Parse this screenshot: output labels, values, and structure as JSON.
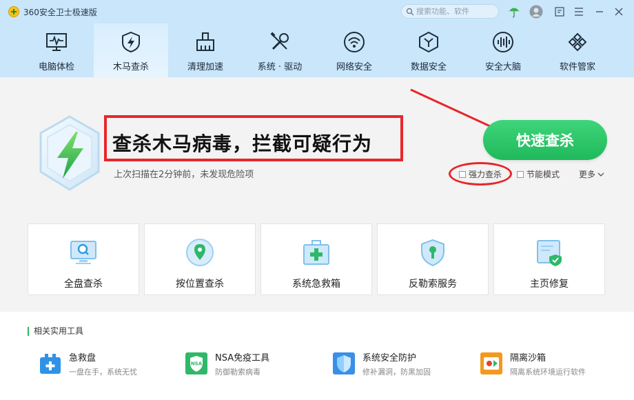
{
  "app": {
    "title": "360安全卫士极速版"
  },
  "search": {
    "placeholder": "搜索功能、软件"
  },
  "nav": {
    "items": [
      {
        "label": "电脑体检"
      },
      {
        "label": "木马查杀"
      },
      {
        "label": "清理加速"
      },
      {
        "label": "系统 · 驱动"
      },
      {
        "label": "网络安全"
      },
      {
        "label": "数据安全"
      },
      {
        "label": "安全大脑"
      },
      {
        "label": "软件管家"
      }
    ],
    "active_index": 1
  },
  "main": {
    "headline": "查杀木马病毒，拦截可疑行为",
    "subline": "上次扫描在2分钟前，未发现危险项",
    "quick_scan_label": "快速查杀",
    "options": [
      {
        "label": "强力查杀",
        "checked": false
      },
      {
        "label": "节能模式",
        "checked": false
      }
    ],
    "more_label": "更多"
  },
  "cards": [
    {
      "label": "全盘查杀",
      "icon": "monitor-search-icon"
    },
    {
      "label": "按位置查杀",
      "icon": "location-pin-icon"
    },
    {
      "label": "系统急救箱",
      "icon": "first-aid-kit-icon"
    },
    {
      "label": "反勒索服务",
      "icon": "shield-lock-icon"
    },
    {
      "label": "主页修复",
      "icon": "homepage-repair-icon"
    }
  ],
  "tools": {
    "title": "相关实用工具",
    "items": [
      {
        "name": "急救盘",
        "desc": "一盘在手，系统无忧",
        "icon": "rescue-disk-icon"
      },
      {
        "name": "NSA免疫工具",
        "desc": "防御勒索病毒",
        "icon": "nsa-icon",
        "badge": "NSA"
      },
      {
        "name": "系统安全防护",
        "desc": "修补漏洞，防黑加固",
        "icon": "security-shield-icon"
      },
      {
        "name": "隔离沙箱",
        "desc": "隔离系统环境运行软件",
        "icon": "sandbox-icon"
      }
    ]
  },
  "colors": {
    "accent_green": "#2ec26a",
    "annotation_red": "#e8262a",
    "nav_bg": "#c9e6fb"
  }
}
